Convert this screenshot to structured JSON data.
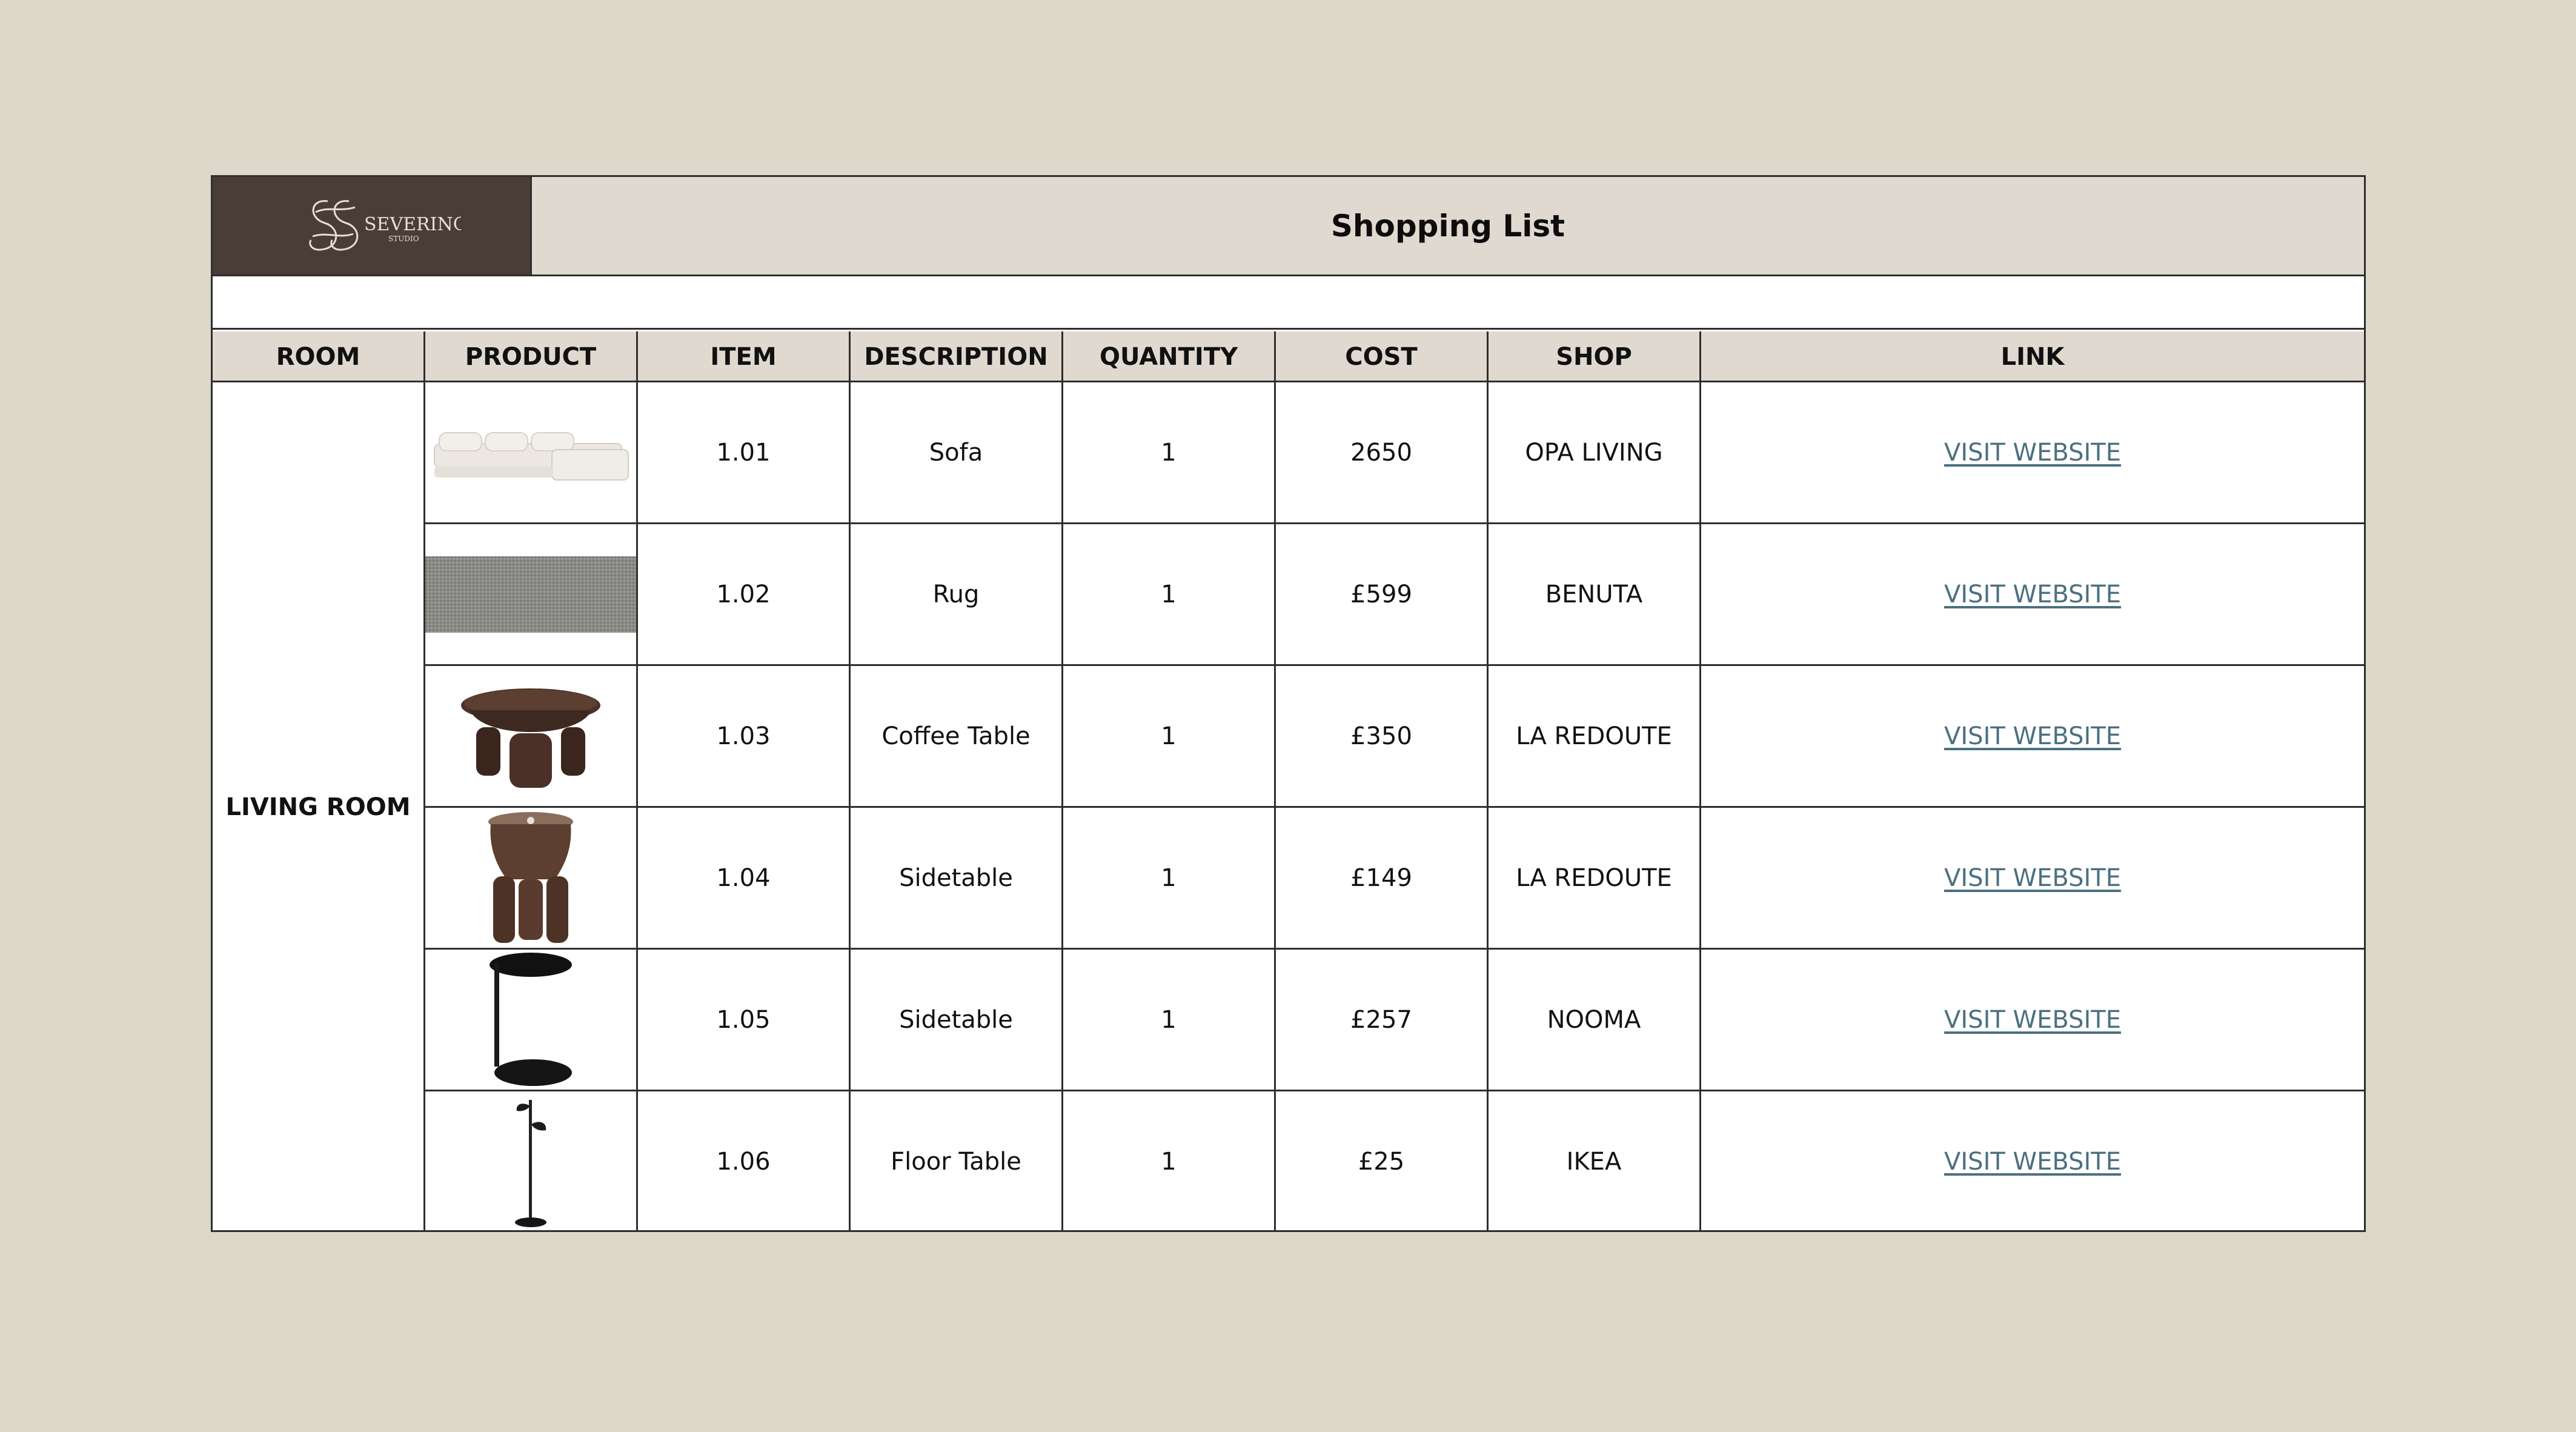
{
  "title": "Shopping List",
  "logo": {
    "monogram": "SS",
    "name": "SEVERINO",
    "tagline": "STUDIO"
  },
  "columns": [
    "ROOM",
    "PRODUCT",
    "ITEM",
    "DESCRIPTION",
    "QUANTITY",
    "COST",
    "SHOP",
    "LINK"
  ],
  "room": "LIVING ROOM",
  "rows": [
    {
      "item": "1.01",
      "description": "Sofa",
      "quantity": "1",
      "cost": "2650",
      "shop": "OPA LIVING",
      "link": "VISIT WEBSITE",
      "icon": "sofa-image"
    },
    {
      "item": "1.02",
      "description": "Rug",
      "quantity": "1",
      "cost": "£599",
      "shop": "BENUTA",
      "link": "VISIT WEBSITE",
      "icon": "rug-image"
    },
    {
      "item": "1.03",
      "description": "Coffee Table",
      "quantity": "1",
      "cost": "£350",
      "shop": "LA REDOUTE",
      "link": "VISIT WEBSITE",
      "icon": "coffee-table-image"
    },
    {
      "item": "1.04",
      "description": "Sidetable",
      "quantity": "1",
      "cost": "£149",
      "shop": "LA REDOUTE",
      "link": "VISIT WEBSITE",
      "icon": "wooden-sidetable-image"
    },
    {
      "item": "1.05",
      "description": "Sidetable",
      "quantity": "1",
      "cost": "£257",
      "shop": "NOOMA",
      "link": "VISIT WEBSITE",
      "icon": "metal-sidetable-image"
    },
    {
      "item": "1.06",
      "description": "Floor Table",
      "quantity": "1",
      "cost": "£25",
      "shop": "IKEA",
      "link": "VISIT WEBSITE",
      "icon": "floor-lamp-image"
    }
  ],
  "colors": {
    "background": "#dbd8ca",
    "header_fill": "#dfd9cf",
    "logo_fill": "#4a3d37",
    "link": "#4b7080"
  }
}
